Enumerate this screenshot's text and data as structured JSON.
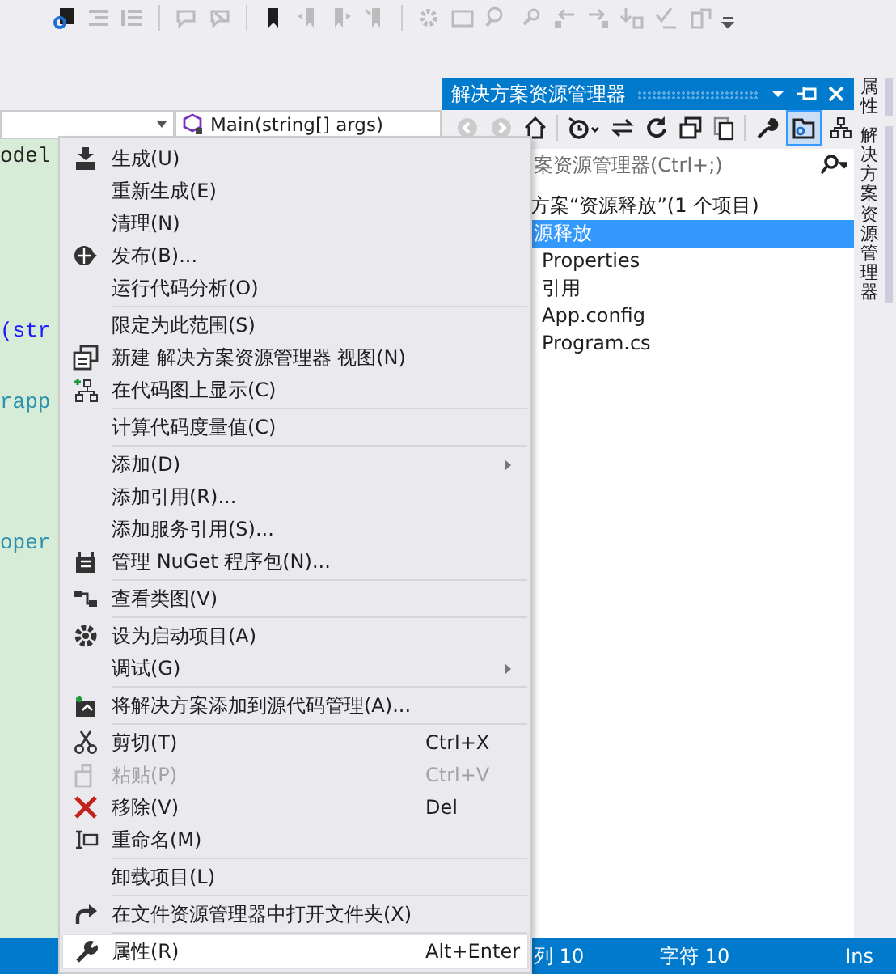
{
  "editor": {
    "member_dropdown": {
      "value": "Main(string[] args)"
    },
    "code_fragments": [
      {
        "text": "odel",
        "kind": "plain"
      },
      {
        "text": "(str",
        "kind": "keyword"
      },
      {
        "text": "rapp",
        "kind": "type"
      },
      {
        "text": "oper",
        "kind": "type"
      }
    ]
  },
  "context_menu": {
    "items": [
      {
        "kind": "item",
        "label": "生成(U)",
        "selected": false,
        "disabled": false
      },
      {
        "kind": "item",
        "label": "重新生成(E)",
        "selected": false,
        "disabled": false
      },
      {
        "kind": "item",
        "label": "清理(N)",
        "selected": false,
        "disabled": false
      },
      {
        "kind": "item",
        "label": "发布(B)...",
        "selected": false,
        "disabled": false
      },
      {
        "kind": "item",
        "label": "运行代码分析(O)",
        "selected": false,
        "disabled": false
      },
      {
        "kind": "separator"
      },
      {
        "kind": "item",
        "label": "限定为此范围(S)",
        "selected": false,
        "disabled": false
      },
      {
        "kind": "item",
        "label": "新建 解决方案资源管理器 视图(N)",
        "selected": false,
        "disabled": false
      },
      {
        "kind": "item",
        "label": "在代码图上显示(C)",
        "selected": false,
        "disabled": false
      },
      {
        "kind": "separator"
      },
      {
        "kind": "item",
        "label": "计算代码度量值(C)",
        "selected": false,
        "disabled": false
      },
      {
        "kind": "separator"
      },
      {
        "kind": "item",
        "label": "添加(D)",
        "selected": false,
        "disabled": false,
        "submenu": true
      },
      {
        "kind": "item",
        "label": "添加引用(R)...",
        "selected": false,
        "disabled": false
      },
      {
        "kind": "item",
        "label": "添加服务引用(S)...",
        "selected": false,
        "disabled": false
      },
      {
        "kind": "item",
        "label": "管理 NuGet 程序包(N)...",
        "selected": false,
        "disabled": false
      },
      {
        "kind": "separator"
      },
      {
        "kind": "item",
        "label": "查看类图(V)",
        "selected": false,
        "disabled": false
      },
      {
        "kind": "separator"
      },
      {
        "kind": "item",
        "label": "设为启动项目(A)",
        "selected": false,
        "disabled": false
      },
      {
        "kind": "item",
        "label": "调试(G)",
        "selected": false,
        "disabled": false,
        "submenu": true
      },
      {
        "kind": "separator"
      },
      {
        "kind": "item",
        "label": "将解决方案添加到源代码管理(A)...",
        "selected": false,
        "disabled": false
      },
      {
        "kind": "separator"
      },
      {
        "kind": "item",
        "label": "剪切(T)",
        "shortcut": "Ctrl+X",
        "selected": false,
        "disabled": false
      },
      {
        "kind": "item",
        "label": "粘贴(P)",
        "shortcut": "Ctrl+V",
        "selected": false,
        "disabled": true
      },
      {
        "kind": "item",
        "label": "移除(V)",
        "shortcut": "Del",
        "selected": false,
        "disabled": false
      },
      {
        "kind": "item",
        "label": "重命名(M)",
        "selected": false,
        "disabled": false
      },
      {
        "kind": "separator"
      },
      {
        "kind": "item",
        "label": "卸载项目(L)",
        "selected": false,
        "disabled": false
      },
      {
        "kind": "separator"
      },
      {
        "kind": "item",
        "label": "在文件资源管理器中打开文件夹(X)",
        "selected": false,
        "disabled": false
      },
      {
        "kind": "separator"
      },
      {
        "kind": "item",
        "label": "属性(R)",
        "shortcut": "Alt+Enter",
        "selected": true,
        "disabled": false
      }
    ]
  },
  "solution_explorer": {
    "title": "解决方案资源管理器",
    "search": {
      "placeholder": "案资源管理器(Ctrl+;)"
    },
    "tree": [
      {
        "label": "方案“资源释放”(1 个项目)",
        "selected": false,
        "children": [
          {
            "label": "源释放",
            "selected": true,
            "children": [
              {
                "label": "Properties",
                "selected": false
              },
              {
                "label": "引用",
                "selected": false
              },
              {
                "label": "App.config",
                "selected": false
              },
              {
                "label": "Program.cs",
                "selected": false
              }
            ]
          }
        ]
      }
    ]
  },
  "side_tabs": [
    {
      "label": "属性"
    },
    {
      "label": "解决方案资源管理器"
    }
  ],
  "status_bar": {
    "items": [
      "列 10",
      "字符 10",
      "Ins"
    ]
  }
}
